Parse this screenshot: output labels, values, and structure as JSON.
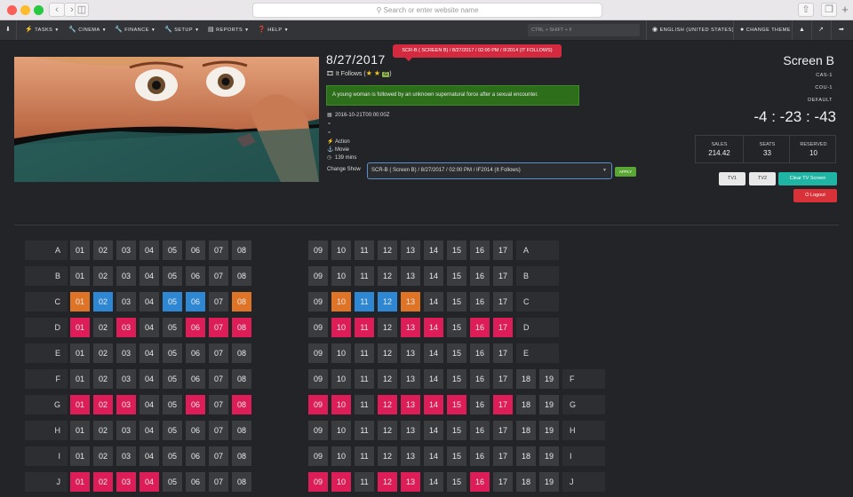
{
  "browser": {
    "address_placeholder": "Search or enter website name"
  },
  "nav": {
    "items": [
      {
        "label": "TASKS",
        "icon": "lightning-icon"
      },
      {
        "label": "CINEMA",
        "icon": "wrench-icon"
      },
      {
        "label": "FINANCE",
        "icon": "wrench-icon"
      },
      {
        "label": "SETUP",
        "icon": "wrench-icon"
      },
      {
        "label": "REPORTS",
        "icon": "bar-chart-icon"
      },
      {
        "label": "HELP",
        "icon": "question-icon"
      }
    ],
    "shortcut_placeholder": "CTRL + SHIFT + F",
    "language": "ENGLISH (UNITED STATES)",
    "theme": "CHANGE THEME"
  },
  "movie": {
    "date": "8/27/2017",
    "tooltip": "SCR-B ( SCREEN B) / 8/27/2017 / 02:00 PM / IF2014 (IT FOLLOWS)",
    "title": "It Follows (",
    "title_close": ")",
    "rating_badge": "G",
    "synopsis": "A young woman is followed by an unknown supernatural force after a sexual encounter.",
    "release": "2016-10-21T00:00:00Z",
    "genre": "Action",
    "type": "Movie",
    "runtime": "139 mins",
    "change_show_label": "Change Show",
    "show_selected": "SCR-B ( Screen B) / 8/27/2017 / 02:00 PM / IF2014 (It Follows)",
    "apply_label": "APPLY"
  },
  "screen": {
    "title": "Screen B",
    "codes": [
      "CAS-1",
      "COU-1",
      "DEFAULT"
    ],
    "countdown": "-4 : -23 : -43",
    "stats": [
      {
        "label": "SALES",
        "value": "214.42"
      },
      {
        "label": "SEATS",
        "value": "33"
      },
      {
        "label": "RESERVED",
        "value": "10"
      }
    ],
    "buttons": {
      "tv1": "TV1",
      "tv2": "TV2",
      "clear": "Clear TV Screen",
      "logout": "Logout"
    }
  },
  "seatmap": {
    "status_colors": {
      "available": "#3b3c3f",
      "sold": "#dd1d58",
      "reserved": "#df7426",
      "selected": "#2d87d2"
    },
    "rows": [
      {
        "row": "A",
        "left": "--------",
        "right": "---------"
      },
      {
        "row": "B",
        "left": "--------",
        "right": "---------"
      },
      {
        "row": "C",
        "left": "rs--ss-r",
        "right": "-rssr----"
      },
      {
        "row": "D",
        "left": "x-x--xxx",
        "right": "-xx-xx-xx"
      },
      {
        "row": "E",
        "left": "--------",
        "right": "---------"
      },
      {
        "row": "F",
        "left": "--------",
        "right": "-----------"
      },
      {
        "row": "G",
        "left": "xxx--x-x",
        "right": "xx-xxxx-x--"
      },
      {
        "row": "H",
        "left": "--------",
        "right": "-----------"
      },
      {
        "row": "I",
        "left": "--------",
        "right": "-----------"
      },
      {
        "row": "J",
        "left": "xxxx----",
        "right": "xx-xx--x---"
      }
    ]
  }
}
